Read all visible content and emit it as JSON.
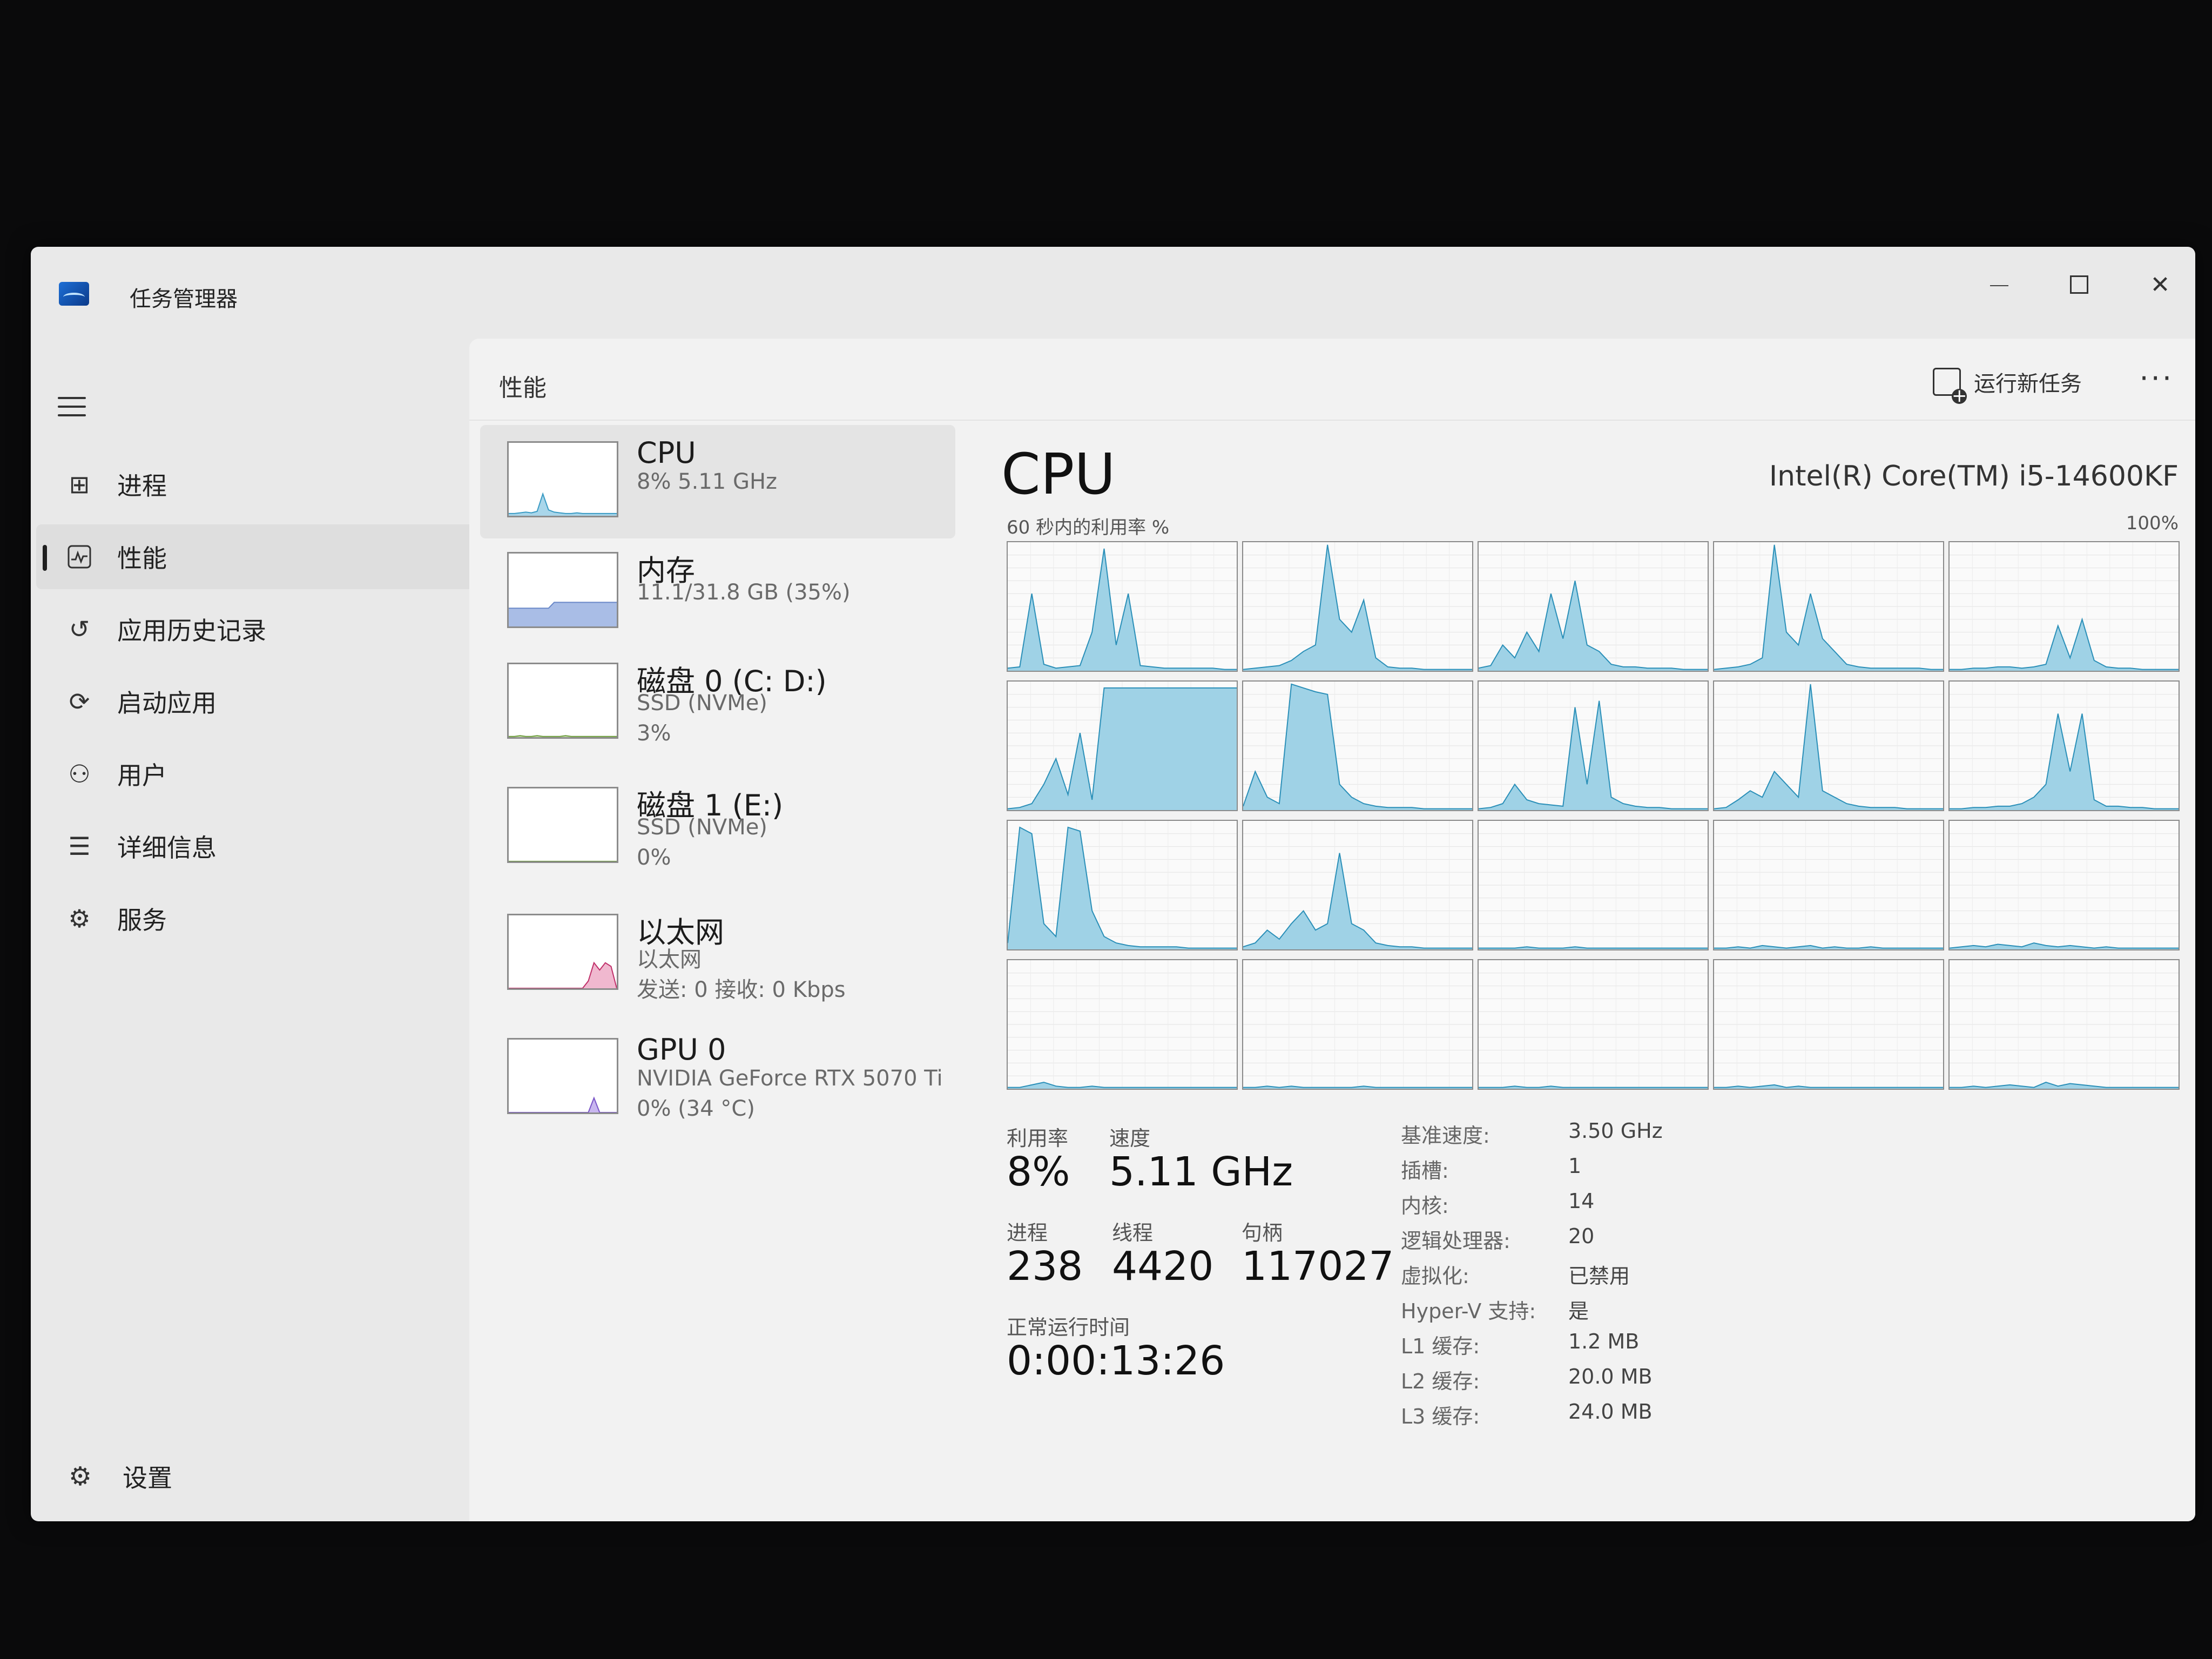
{
  "app": {
    "title": "任务管理器"
  },
  "nav": {
    "items": [
      {
        "label": "进程",
        "icon": "processes-icon"
      },
      {
        "label": "性能",
        "icon": "performance-icon"
      },
      {
        "label": "应用历史记录",
        "icon": "app-history-icon"
      },
      {
        "label": "启动应用",
        "icon": "startup-apps-icon"
      },
      {
        "label": "用户",
        "icon": "users-icon"
      },
      {
        "label": "详细信息",
        "icon": "details-icon"
      },
      {
        "label": "服务",
        "icon": "services-icon"
      }
    ],
    "active_index": 1,
    "settings_label": "设置"
  },
  "header": {
    "title": "性能",
    "run_new_task": "运行新任务",
    "more": "···"
  },
  "devices": [
    {
      "name": "CPU",
      "line1": "8%  5.11 GHz",
      "line2": "",
      "color": "#3a9bc4",
      "fill": "#a9d6ea"
    },
    {
      "name": "内存",
      "line1": "11.1/31.8 GB (35%)",
      "line2": "",
      "color": "#6a88c8",
      "fill": "#a9bde6"
    },
    {
      "name": "磁盘 0 (C: D:)",
      "line1": "SSD (NVMe)",
      "line2": "3%",
      "color": "#6b9b3a",
      "fill": "#cfe3b8"
    },
    {
      "name": "磁盘 1 (E:)",
      "line1": "SSD (NVMe)",
      "line2": "0%",
      "color": "#6b9b3a",
      "fill": "#cfe3b8"
    },
    {
      "name": "以太网",
      "line1": "以太网",
      "line2": "发送: 0 接收: 0 Kbps",
      "color": "#c0306a",
      "fill": "#f0b8cf"
    },
    {
      "name": "GPU 0",
      "line1": "NVIDIA GeForce RTX 5070 Ti",
      "line2": "0% (34 °C)",
      "color": "#7a55c8",
      "fill": "#c8b6ef"
    }
  ],
  "cpu": {
    "title": "CPU",
    "model": "Intel(R) Core(TM) i5-14600KF",
    "util_label": "60 秒内的利用率 %",
    "max_label": "100%",
    "stats": {
      "util_label": "利用率",
      "util_value": "8%",
      "speed_label": "速度",
      "speed_value": "5.11 GHz",
      "proc_label": "进程",
      "proc_value": "238",
      "thread_label": "线程",
      "thread_value": "4420",
      "handle_label": "句柄",
      "handle_value": "117027",
      "uptime_label": "正常运行时间",
      "uptime_value": "0:00:13:26"
    },
    "info": [
      {
        "key": "基准速度:",
        "value": "3.50 GHz"
      },
      {
        "key": "插槽:",
        "value": "1"
      },
      {
        "key": "内核:",
        "value": "14"
      },
      {
        "key": "逻辑处理器:",
        "value": "20"
      },
      {
        "key": "虚拟化:",
        "value": "已禁用"
      },
      {
        "key": "Hyper-V 支持:",
        "value": "是"
      },
      {
        "key": "L1 缓存:",
        "value": "1.2 MB"
      },
      {
        "key": "L2 缓存:",
        "value": "20.0 MB"
      },
      {
        "key": "L3 缓存:",
        "value": "24.0 MB"
      }
    ]
  },
  "chart_data": {
    "type": "area",
    "description_units": "percent utilization over 60 seconds per logical processor",
    "ylim": [
      0,
      100
    ],
    "series": [
      {
        "values": [
          2,
          3,
          60,
          5,
          2,
          3,
          4,
          30,
          95,
          20,
          60,
          4,
          3,
          2,
          2,
          2,
          2,
          2,
          1,
          1
        ]
      },
      {
        "values": [
          1,
          2,
          3,
          4,
          8,
          15,
          20,
          98,
          40,
          30,
          55,
          10,
          3,
          2,
          2,
          1,
          1,
          1,
          1,
          1
        ]
      },
      {
        "values": [
          2,
          4,
          20,
          10,
          30,
          15,
          60,
          25,
          70,
          20,
          15,
          5,
          3,
          3,
          2,
          2,
          2,
          1,
          1,
          1
        ]
      },
      {
        "values": [
          1,
          2,
          3,
          5,
          10,
          98,
          30,
          20,
          60,
          25,
          15,
          5,
          3,
          2,
          2,
          2,
          2,
          2,
          1,
          1
        ]
      },
      {
        "values": [
          1,
          1,
          2,
          2,
          3,
          3,
          2,
          3,
          5,
          35,
          10,
          40,
          8,
          3,
          2,
          2,
          1,
          1,
          1,
          1
        ]
      },
      {
        "values": [
          1,
          2,
          5,
          20,
          40,
          12,
          60,
          8,
          95,
          95,
          95,
          95,
          95,
          95,
          95,
          95,
          95,
          95,
          95,
          95
        ]
      },
      {
        "values": [
          3,
          30,
          10,
          5,
          98,
          95,
          92,
          90,
          20,
          10,
          5,
          3,
          2,
          2,
          2,
          1,
          1,
          1,
          1,
          1
        ]
      },
      {
        "values": [
          1,
          2,
          5,
          20,
          8,
          5,
          4,
          3,
          80,
          20,
          85,
          10,
          5,
          3,
          2,
          2,
          1,
          1,
          1,
          1
        ]
      },
      {
        "values": [
          1,
          2,
          8,
          15,
          10,
          30,
          20,
          10,
          98,
          15,
          10,
          5,
          3,
          2,
          2,
          2,
          1,
          1,
          1,
          1
        ]
      },
      {
        "values": [
          1,
          1,
          2,
          2,
          3,
          3,
          5,
          10,
          20,
          75,
          30,
          75,
          8,
          3,
          3,
          2,
          2,
          1,
          1,
          1
        ]
      },
      {
        "values": [
          5,
          95,
          90,
          20,
          10,
          95,
          92,
          30,
          10,
          5,
          3,
          2,
          2,
          2,
          2,
          1,
          1,
          1,
          1,
          1
        ]
      },
      {
        "values": [
          2,
          5,
          15,
          8,
          20,
          30,
          15,
          20,
          75,
          20,
          15,
          5,
          3,
          2,
          2,
          1,
          1,
          1,
          1,
          1
        ]
      },
      {
        "values": [
          1,
          1,
          1,
          1,
          2,
          1,
          1,
          1,
          2,
          1,
          1,
          1,
          1,
          1,
          1,
          1,
          1,
          1,
          1,
          1
        ]
      },
      {
        "values": [
          1,
          1,
          2,
          1,
          3,
          2,
          1,
          2,
          3,
          1,
          2,
          1,
          1,
          2,
          1,
          1,
          1,
          1,
          1,
          1
        ]
      },
      {
        "values": [
          1,
          2,
          3,
          2,
          4,
          3,
          2,
          5,
          3,
          2,
          3,
          2,
          1,
          2,
          1,
          1,
          1,
          1,
          1,
          1
        ]
      },
      {
        "values": [
          1,
          1,
          3,
          5,
          2,
          1,
          1,
          2,
          1,
          1,
          1,
          1,
          1,
          1,
          1,
          1,
          1,
          1,
          1,
          1
        ]
      },
      {
        "values": [
          1,
          1,
          2,
          1,
          2,
          1,
          1,
          1,
          1,
          1,
          2,
          1,
          1,
          1,
          1,
          1,
          1,
          1,
          1,
          1
        ]
      },
      {
        "values": [
          1,
          1,
          1,
          2,
          1,
          1,
          2,
          1,
          1,
          1,
          1,
          1,
          1,
          1,
          1,
          1,
          1,
          1,
          1,
          1
        ]
      },
      {
        "values": [
          1,
          1,
          2,
          1,
          2,
          3,
          1,
          2,
          1,
          1,
          1,
          1,
          1,
          1,
          1,
          1,
          1,
          1,
          1,
          1
        ]
      },
      {
        "values": [
          1,
          1,
          2,
          1,
          2,
          3,
          2,
          1,
          5,
          2,
          4,
          3,
          2,
          1,
          1,
          1,
          1,
          1,
          1,
          1
        ]
      }
    ],
    "thumbnails": {
      "cpu": [
        3,
        3,
        4,
        5,
        4,
        6,
        30,
        8,
        5,
        4,
        3,
        3,
        4,
        3,
        3,
        3,
        3,
        3,
        3,
        3
      ],
      "memory": [
        25,
        25,
        25,
        25,
        25,
        25,
        25,
        25,
        33,
        33,
        33,
        33,
        33,
        33,
        33,
        33,
        33,
        33,
        33,
        33
      ],
      "disk0": [
        1,
        1,
        2,
        1,
        1,
        2,
        1,
        1,
        1,
        1,
        2,
        1,
        1,
        1,
        1,
        1,
        1,
        1,
        1,
        1
      ],
      "disk1": [
        0,
        0,
        0,
        0,
        0,
        0,
        0,
        0,
        0,
        0,
        0,
        0,
        0,
        0,
        0,
        0,
        0,
        0,
        0,
        0
      ],
      "ethernet": [
        0,
        0,
        0,
        0,
        0,
        0,
        0,
        0,
        0,
        0,
        0,
        0,
        0,
        0,
        10,
        35,
        25,
        35,
        30,
        0
      ],
      "gpu": [
        0,
        0,
        0,
        0,
        0,
        0,
        0,
        0,
        0,
        0,
        0,
        0,
        0,
        0,
        0,
        20,
        0,
        0,
        0,
        0
      ]
    }
  }
}
